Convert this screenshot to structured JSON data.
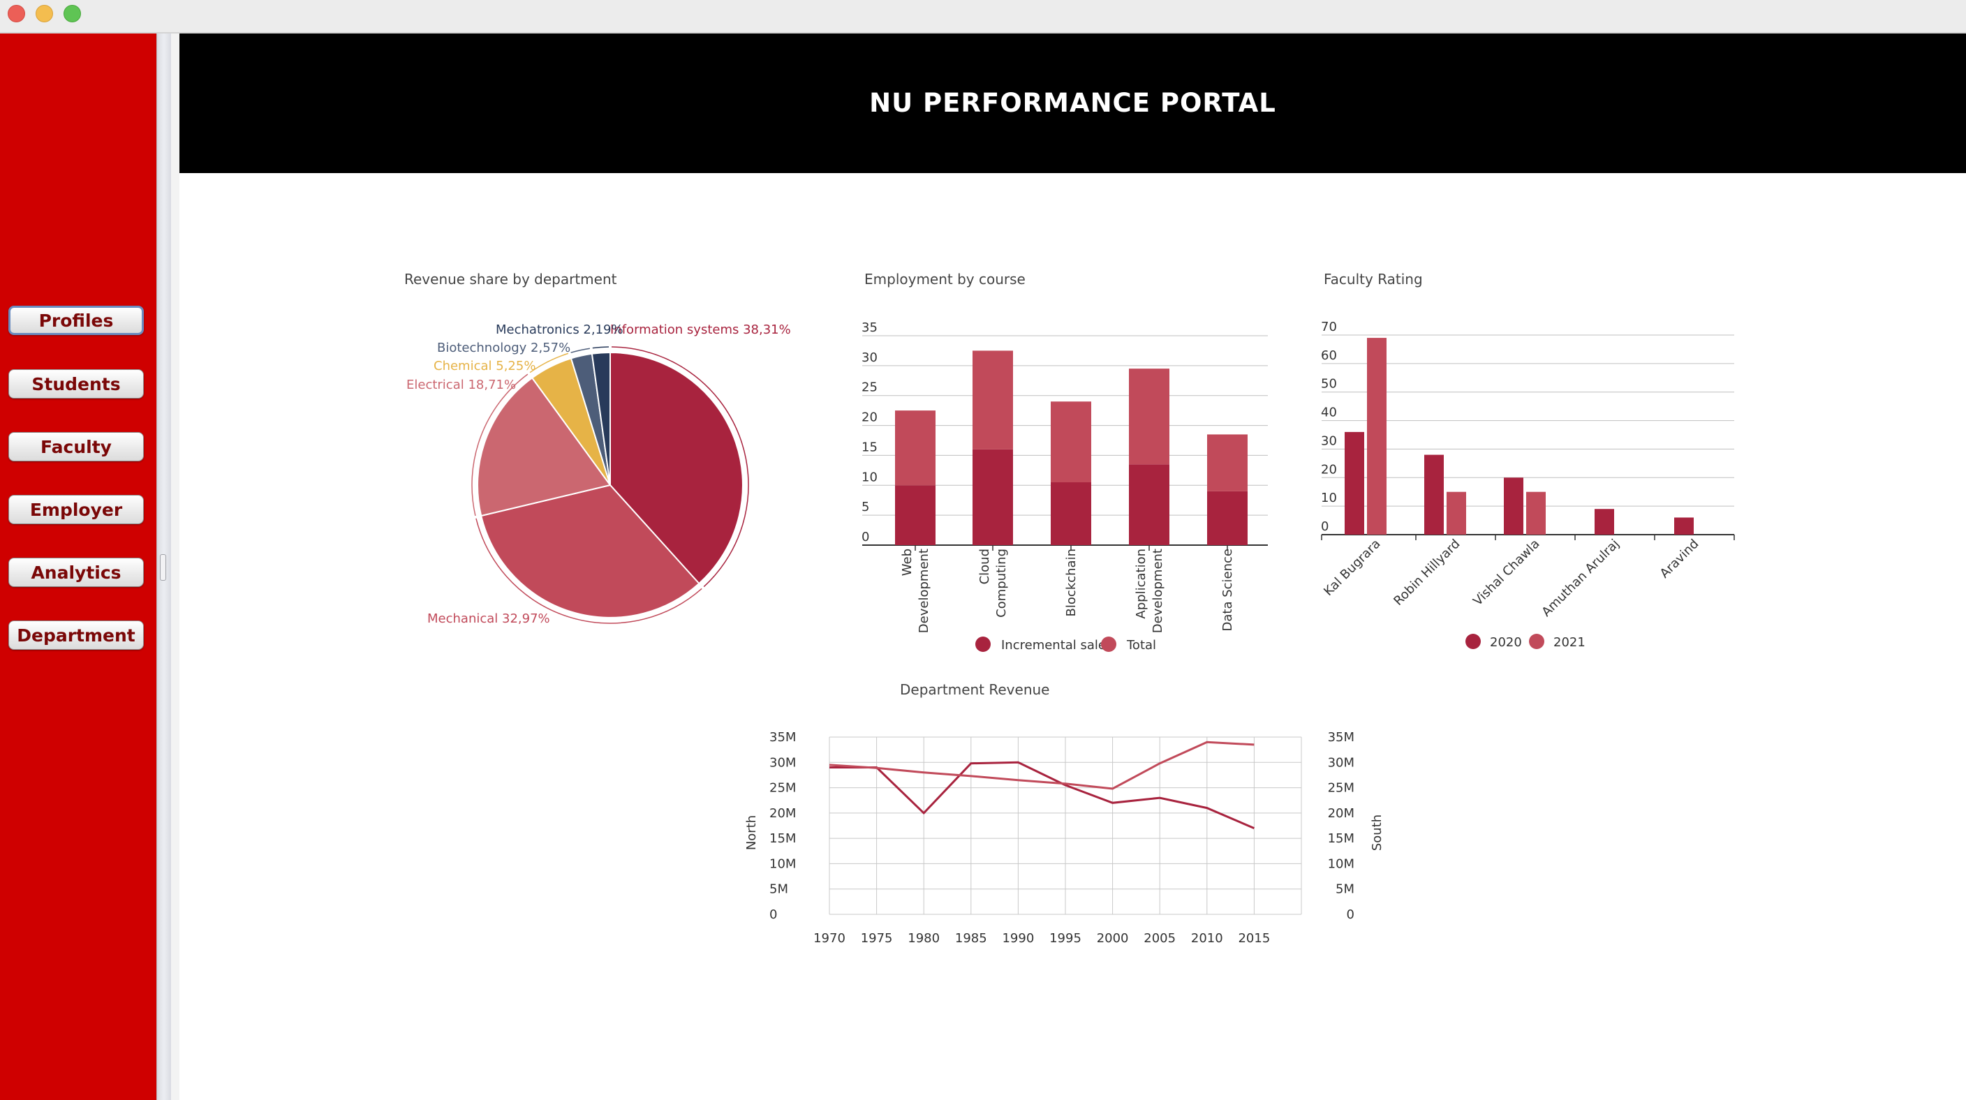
{
  "window": {
    "controls": [
      "close",
      "minimize",
      "maximize"
    ]
  },
  "header": {
    "title": "NU PERFORMANCE PORTAL"
  },
  "nav": {
    "items": [
      {
        "label": "Profiles",
        "selected": true
      },
      {
        "label": "Students",
        "selected": false
      },
      {
        "label": "Faculty",
        "selected": false
      },
      {
        "label": "Employer",
        "selected": false
      },
      {
        "label": "Analytics",
        "selected": false
      },
      {
        "label": "Department",
        "selected": false
      }
    ]
  },
  "colors": {
    "sidebar": "#cf0000",
    "primary": "#a8233e",
    "secondary": "#c14a5a",
    "light": "#cb6770",
    "amber": "#e6b347",
    "slate": "#4d5d79",
    "navy": "#283a5a"
  },
  "chart_data": [
    {
      "id": "pie",
      "type": "pie",
      "title": "Revenue share by department",
      "slices": [
        {
          "label": "Information systems",
          "display": "Information systems 38,31%",
          "value": 38.31,
          "color": "#a8233e"
        },
        {
          "label": "Mechanical",
          "display": "Mechanical 32,97%",
          "value": 32.97,
          "color": "#c14a5a"
        },
        {
          "label": "Electrical",
          "display": "Electrical 18,71%",
          "value": 18.71,
          "color": "#cb6770"
        },
        {
          "label": "Chemical",
          "display": "Chemical 5,25%",
          "value": 5.25,
          "color": "#e6b347"
        },
        {
          "label": "Biotechnology",
          "display": "Biotechnology 2,57%",
          "value": 2.57,
          "color": "#4d5d79"
        },
        {
          "label": "Mechatronics",
          "display": "Mechatronics 2,19%",
          "value": 2.19,
          "color": "#283a5a"
        }
      ]
    },
    {
      "id": "employment",
      "type": "bar",
      "stacked": true,
      "title": "Employment by course",
      "categories": [
        "Web Development",
        "Cloud Computing",
        "Blockchain",
        "Application Development",
        "Data Science"
      ],
      "series": [
        {
          "name": "Incremental sale",
          "values": [
            10,
            16,
            10.5,
            13.5,
            9
          ],
          "color": "#a8233e"
        },
        {
          "name": "Total",
          "values": [
            12.5,
            16.5,
            13.5,
            16,
            9.5
          ],
          "color": "#c14a5a"
        }
      ],
      "yticks": [
        0,
        5,
        10,
        15,
        20,
        25,
        30,
        35
      ],
      "ylim": [
        0,
        35
      ],
      "grid": true,
      "legend": "bottom"
    },
    {
      "id": "faculty",
      "type": "bar",
      "title": "Faculty Rating",
      "categories": [
        "Kal Bugrara",
        "Robin Hillyard",
        "Vishal Chawla",
        "Amuthan Arulraj",
        "Aravind"
      ],
      "series": [
        {
          "name": "2020",
          "values": [
            36,
            28,
            20,
            9,
            6
          ],
          "color": "#a8233e"
        },
        {
          "name": "2021",
          "values": [
            69,
            15,
            15,
            0,
            0
          ],
          "color": "#c14a5a"
        }
      ],
      "yticks": [
        0,
        10,
        20,
        30,
        40,
        50,
        60,
        70
      ],
      "ylim": [
        0,
        70
      ],
      "grid": true,
      "legend": "bottom"
    },
    {
      "id": "revenue",
      "type": "line",
      "title": "Department Revenue",
      "x": [
        1970,
        1975,
        1980,
        1985,
        1990,
        1995,
        2000,
        2005,
        2010,
        2015
      ],
      "series": [
        {
          "name": "North",
          "values": [
            29,
            29,
            20,
            29.8,
            30,
            25.5,
            22,
            23,
            21,
            17
          ],
          "color": "#a8233e"
        },
        {
          "name": "South",
          "values": [
            29.5,
            28.9,
            28,
            27.3,
            26.5,
            25.8,
            24.8,
            29.8,
            34,
            33.5
          ],
          "color": "#c14a5a"
        }
      ],
      "yticks": [
        "0",
        "5M",
        "10M",
        "15M",
        "20M",
        "25M",
        "30M",
        "35M"
      ],
      "ylim": [
        0,
        35
      ],
      "ylabel_left": "North",
      "ylabel_right": "South",
      "grid": true
    }
  ]
}
